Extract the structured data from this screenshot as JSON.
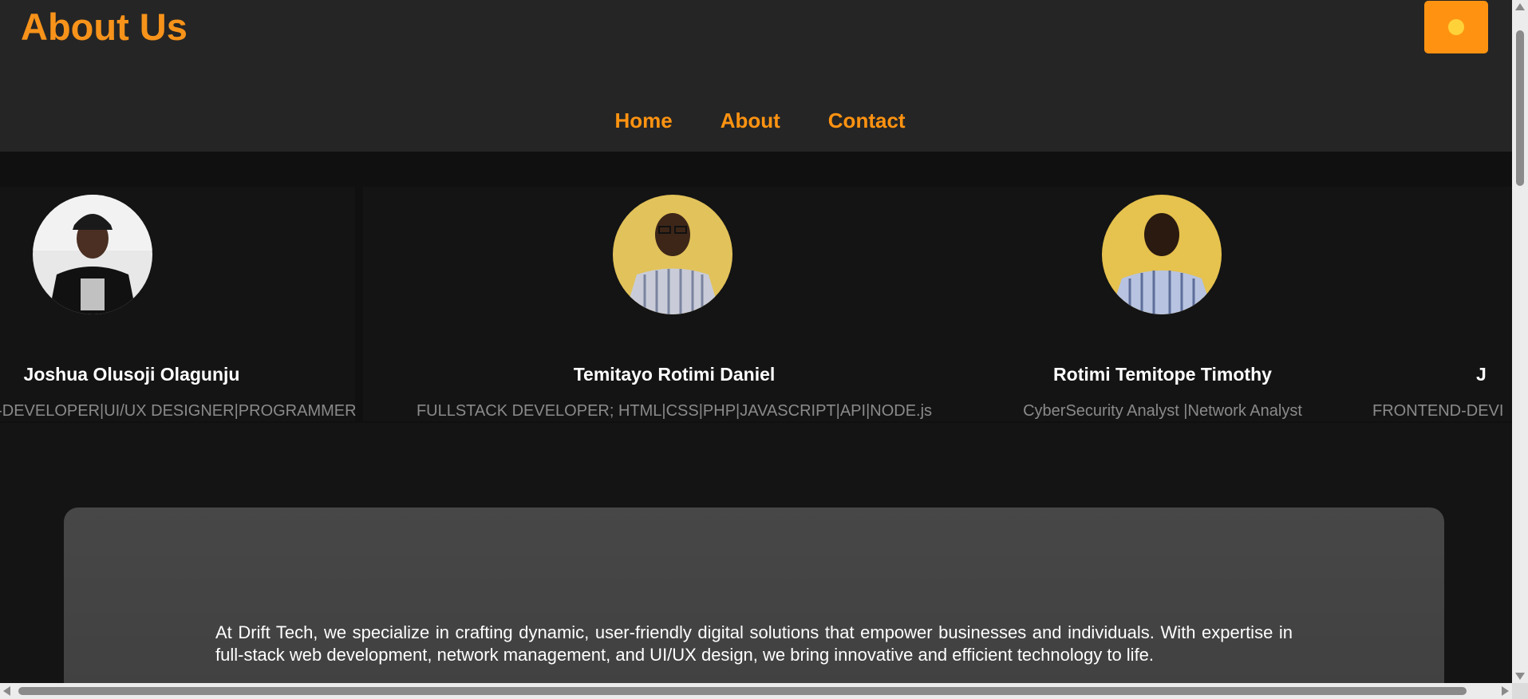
{
  "header": {
    "title": "About Us",
    "theme_toggle_icon": "sun-icon"
  },
  "nav": {
    "items": [
      {
        "label": "Home"
      },
      {
        "label": "About"
      },
      {
        "label": "Contact"
      }
    ]
  },
  "team": {
    "members": [
      {
        "name": "Joshua Olusoji Olagunju",
        "role": "FRONTEND-DEVELOPER|UI/UX DESIGNER|PROGRAMMER",
        "avatar_icon": "person-photo-icon"
      },
      {
        "name": "Temitayo Rotimi Daniel",
        "role": "FULLSTACK DEVELOPER; HTML|CSS|PHP|JAVASCRIPT|API|NODE.js",
        "avatar_icon": "person-photo-icon"
      },
      {
        "name": "Rotimi Temitope Timothy",
        "role": "CyberSecurity Analyst |Network Analyst",
        "avatar_icon": "person-photo-icon"
      },
      {
        "name": "J",
        "role": "FRONTEND-DEVI",
        "avatar_icon": "person-photo-icon"
      }
    ]
  },
  "about": {
    "text": "At Drift Tech, we specialize in crafting dynamic, user-friendly digital solutions that empower businesses and individuals. With expertise in full-stack web development, network management, and UI/UX design, we bring innovative and efficient technology to life."
  },
  "colors": {
    "accent": "#ff9311",
    "header_bg": "#252525",
    "page_bg": "#141414",
    "card_bg": "#404040"
  }
}
